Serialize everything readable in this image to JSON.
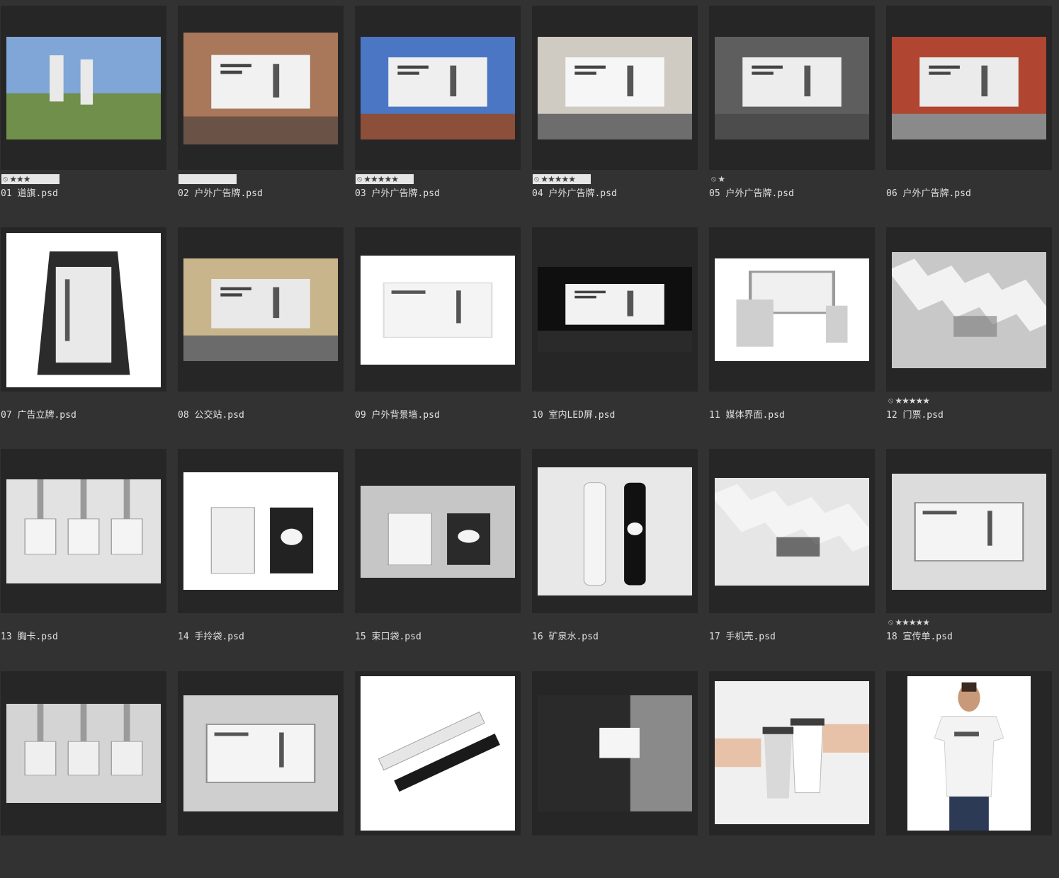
{
  "colors": {
    "background": "#323232",
    "tile": "#262626",
    "label": "#e0e0e0"
  },
  "files": [
    {
      "name": "01 道旗.psd",
      "rating": {
        "shown": true,
        "boxed": true,
        "stars": "★★★",
        "reject_icon": "no-entry-icon"
      }
    },
    {
      "name": "02 户外广告牌.psd",
      "rating": {
        "shown": true,
        "boxed": true,
        "stars": "",
        "reject_icon": ""
      }
    },
    {
      "name": "03 户外广告牌.psd",
      "rating": {
        "shown": true,
        "boxed": true,
        "stars": "★★★★★",
        "reject_icon": "no-entry-icon"
      }
    },
    {
      "name": "04 户外广告牌.psd",
      "rating": {
        "shown": true,
        "boxed": true,
        "stars": "★★★★★",
        "reject_icon": "no-entry-icon"
      }
    },
    {
      "name": "05 户外广告牌.psd",
      "rating": {
        "shown": true,
        "boxed": false,
        "stars": "★",
        "reject_icon": "no-entry-icon"
      }
    },
    {
      "name": "06 户外广告牌.psd",
      "rating": {
        "shown": false
      }
    },
    {
      "name": "07 广告立牌.psd",
      "rating": {
        "shown": false
      }
    },
    {
      "name": "08 公交站.psd",
      "rating": {
        "shown": false
      }
    },
    {
      "name": "09 户外背景墙.psd",
      "rating": {
        "shown": false
      }
    },
    {
      "name": "10 室内LED屏.psd",
      "rating": {
        "shown": false
      }
    },
    {
      "name": "11 媒体界面.psd",
      "rating": {
        "shown": false
      }
    },
    {
      "name": "12 门票.psd",
      "rating": {
        "shown": true,
        "boxed": false,
        "stars": "★★★★★",
        "reject_icon": "no-entry-icon"
      }
    },
    {
      "name": "13 胸卡.psd",
      "rating": {
        "shown": false
      }
    },
    {
      "name": "14 手拎袋.psd",
      "rating": {
        "shown": false
      }
    },
    {
      "name": "15 束口袋.psd",
      "rating": {
        "shown": false
      }
    },
    {
      "name": "16 矿泉水.psd",
      "rating": {
        "shown": false
      }
    },
    {
      "name": "17 手机壳.psd",
      "rating": {
        "shown": false
      }
    },
    {
      "name": "18 宣传单.psd",
      "rating": {
        "shown": true,
        "boxed": false,
        "stars": "★★★★★",
        "reject_icon": "no-entry-icon"
      }
    },
    {
      "name": "",
      "rating": {
        "shown": false
      }
    },
    {
      "name": "",
      "rating": {
        "shown": false
      }
    },
    {
      "name": "",
      "rating": {
        "shown": false
      }
    },
    {
      "name": "",
      "rating": {
        "shown": false
      }
    },
    {
      "name": "",
      "rating": {
        "shown": false
      }
    },
    {
      "name": "",
      "rating": {
        "shown": false
      }
    }
  ]
}
